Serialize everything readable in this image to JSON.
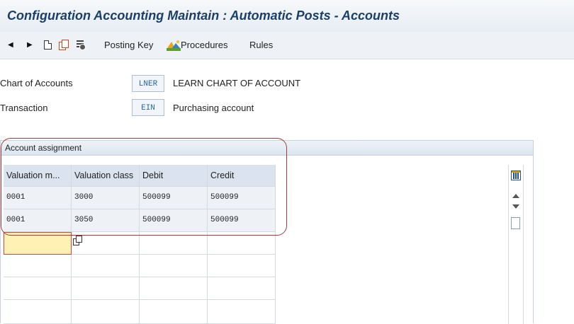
{
  "window": {
    "title": "Configuration Accounting Maintain : Automatic Posts - Accounts"
  },
  "toolbar": {
    "back_icon": "triangle-left",
    "forward_icon": "triangle-right",
    "new_icon": "document",
    "copy_icon": "copy",
    "delimit_icon": "delimit",
    "posting_key_label": "Posting Key",
    "procedures_icon": "mountain-landscape",
    "procedures_label": "Procedures",
    "rules_label": "Rules"
  },
  "header_fields": {
    "chart_of_accounts": {
      "label": "Chart of Accounts",
      "value": "LNER",
      "description": "LEARN CHART OF ACCOUNT"
    },
    "transaction": {
      "label": "Transaction",
      "value": "EIN",
      "description": "Purchasing account"
    }
  },
  "account_assignment": {
    "title": "Account assignment",
    "columns": [
      "Valuation m...",
      "Valuation class",
      "Debit",
      "Credit"
    ],
    "rows": [
      [
        "0001",
        "3000",
        "500099",
        "500099"
      ],
      [
        "0001",
        "3050",
        "500099",
        "500099"
      ]
    ],
    "settings_icon": "table-settings",
    "value_help_icon": "f4-help"
  },
  "colors": {
    "title": "#1b3f6a",
    "grid_header": "#dbe4ee",
    "grid_row": "#eef2f7",
    "active_cell": "#fff0b3",
    "highlight": "#a63b3b"
  }
}
